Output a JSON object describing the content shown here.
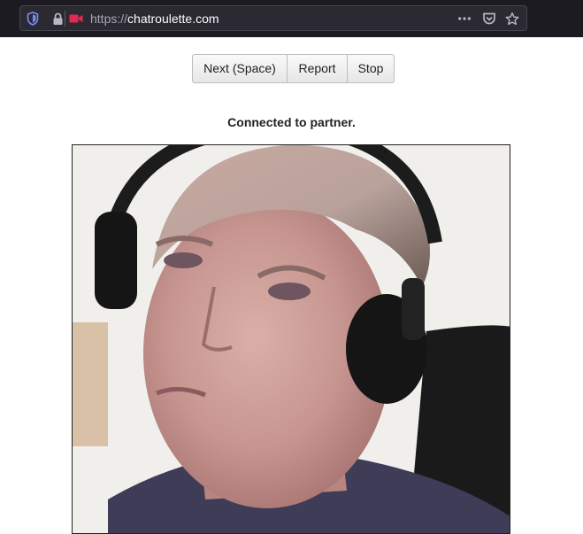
{
  "browser": {
    "url_scheme": "https://",
    "url_host": "chatroulette.com",
    "icons": [
      "shield-icon",
      "lock-icon",
      "camera-icon",
      "more-icon",
      "pocket-icon",
      "bookmark-star-icon"
    ]
  },
  "toolbar": {
    "next_label": "Next (Space)",
    "report_label": "Report",
    "stop_label": "Stop"
  },
  "status": {
    "text": "Connected to partner."
  },
  "video": {
    "icon": "partner-video-feed"
  },
  "colors": {
    "chrome_bg": "#1c1b22",
    "urlbar_bg": "#2b2a33",
    "shield": "#7b8cf7",
    "camera": "#e22850"
  }
}
